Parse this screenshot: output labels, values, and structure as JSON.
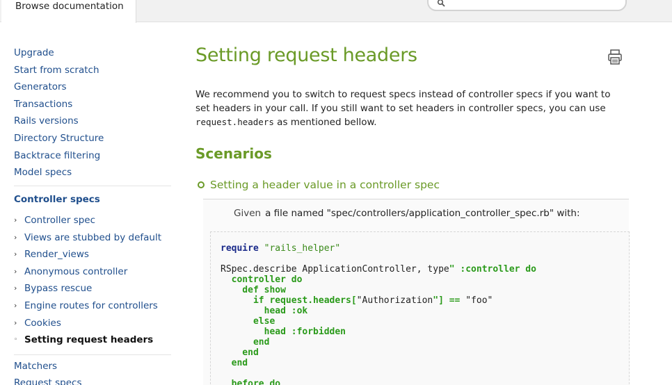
{
  "header": {
    "tab_label": "Browse documentation",
    "search_placeholder": ""
  },
  "sidebar": {
    "links": [
      "Upgrade",
      "Start from scratch",
      "Generators",
      "Transactions",
      "Rails versions",
      "Directory Structure",
      "Backtrace filtering",
      "Model specs"
    ],
    "section_heading": "Controller specs",
    "sub_items": [
      {
        "label": "Controller spec",
        "bullet": "›"
      },
      {
        "label": "Views are stubbed by default",
        "bullet": "›"
      },
      {
        "label": "Render_views",
        "bullet": "›"
      },
      {
        "label": "Anonymous controller",
        "bullet": "›"
      },
      {
        "label": "Bypass rescue",
        "bullet": "›"
      },
      {
        "label": "Engine routes for controllers",
        "bullet": "›"
      },
      {
        "label": "Cookies",
        "bullet": "›"
      },
      {
        "label": "Setting request headers",
        "bullet": "◦",
        "active": true
      }
    ],
    "after_links": [
      "Matchers",
      "Request specs"
    ]
  },
  "main": {
    "title": "Setting request headers",
    "intro_part1": "We recommend you to switch to request specs instead of controller specs if you want to set headers in your call. If you still want to set headers in controller specs, you can use ",
    "intro_code": "request.headers",
    "intro_part2": " as mentioned bellow.",
    "section_title": "Scenarios",
    "scenario_title": "Setting a header value in a controller spec",
    "step_keyword": "Given",
    "step_text": "a file named \"spec/controllers/application_controller_spec.rb\" with:",
    "code_lines": [
      [
        {
          "t": "require",
          "c": "#1a2a8a",
          "b": true
        },
        {
          "t": " \"rails_helper\"",
          "c": "#3a8a1a",
          "b": false
        }
      ],
      [],
      [
        {
          "t": "RSpec.describe ApplicationController, type",
          "c": "#222222",
          "b": false
        },
        {
          "t": "\" :controller do",
          "c": "#2a9a1a",
          "b": true
        }
      ],
      [
        {
          "t": "  controller do",
          "c": "#2a9a1a",
          "b": true
        }
      ],
      [
        {
          "t": "    def show",
          "c": "#2a9a1a",
          "b": true
        }
      ],
      [
        {
          "t": "      if request.headers[",
          "c": "#2a9a1a",
          "b": true
        },
        {
          "t": "\"Authorization",
          "c": "#222222",
          "b": false
        },
        {
          "t": "\"] == ",
          "c": "#2a9a1a",
          "b": true
        },
        {
          "t": "\"foo\"",
          "c": "#222222",
          "b": false
        }
      ],
      [
        {
          "t": "        head :ok",
          "c": "#2a9a1a",
          "b": true
        }
      ],
      [
        {
          "t": "      else",
          "c": "#2a9a1a",
          "b": true
        }
      ],
      [
        {
          "t": "        head :forbidden",
          "c": "#2a9a1a",
          "b": true
        }
      ],
      [
        {
          "t": "      end",
          "c": "#2a9a1a",
          "b": true
        }
      ],
      [
        {
          "t": "    end",
          "c": "#2a9a1a",
          "b": true
        }
      ],
      [
        {
          "t": "  end",
          "c": "#2a9a1a",
          "b": true
        }
      ],
      [],
      [
        {
          "t": "  before do",
          "c": "#2a9a1a",
          "b": true
        }
      ]
    ]
  },
  "colors": {
    "accent_green": "#6a9a27",
    "link_blue": "#1f4e8c"
  }
}
